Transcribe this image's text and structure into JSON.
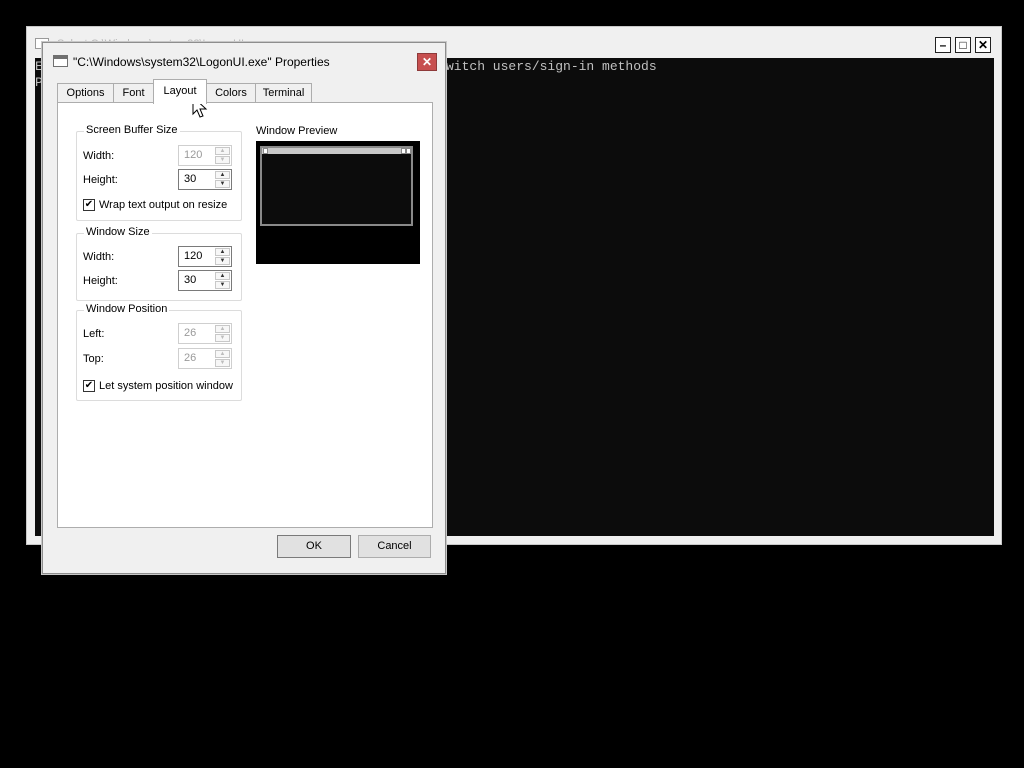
{
  "console": {
    "title": "Select C:\\Windows\\system32\\LogonUI.exe",
    "lines": [
      "E",
      "P"
    ],
    "visible_text": "witch users/sign-in methods",
    "minimize_glyph": "–",
    "maximize_glyph": "□",
    "close_glyph": "✕"
  },
  "dialog": {
    "title": "\"C:\\Windows\\system32\\LogonUI.exe\" Properties",
    "close_glyph": "✕",
    "tabs": [
      "Options",
      "Font",
      "Layout",
      "Colors",
      "Terminal"
    ],
    "active_tab": "Layout",
    "screen_buffer": {
      "legend": "Screen Buffer Size",
      "width_label": "Width:",
      "width_value": "120",
      "height_label": "Height:",
      "height_value": "30",
      "wrap_label": "Wrap text output on resize",
      "wrap_checked": true
    },
    "window_size": {
      "legend": "Window Size",
      "width_label": "Width:",
      "width_value": "120",
      "height_label": "Height:",
      "height_value": "30"
    },
    "window_position": {
      "legend": "Window Position",
      "left_label": "Left:",
      "left_value": "26",
      "top_label": "Top:",
      "top_value": "26",
      "let_system_label": "Let system position window",
      "let_system_checked": true
    },
    "preview": {
      "label": "Window Preview"
    },
    "buttons": {
      "ok": "OK",
      "cancel": "Cancel"
    }
  }
}
